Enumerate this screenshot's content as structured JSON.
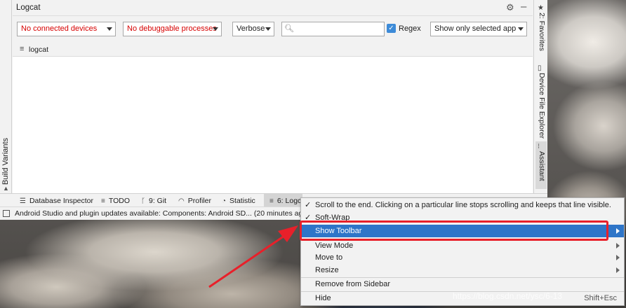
{
  "logcat_panel": {
    "title": "Logcat",
    "device_combo": "No connected devices",
    "process_combo": "No debuggable processes",
    "level_combo": "Verbose",
    "search": {
      "value": "",
      "placeholder": ""
    },
    "regex_label": "Regex",
    "regex_checked": true,
    "filter_combo": "Show only selected app",
    "sub_tab": "logcat"
  },
  "left_sidebar": {
    "build_variants": "Build Variants"
  },
  "right_sidebar": {
    "favorites": "2: Favorites",
    "device_file_explorer": "Device File Explorer",
    "assistant": "Assistant"
  },
  "bottom_tabs": [
    {
      "label": "Database Inspector",
      "icon": "database-icon"
    },
    {
      "label": "TODO",
      "icon": "list-icon"
    },
    {
      "label": "9: Git",
      "icon": "branch-icon"
    },
    {
      "label": "Profiler",
      "icon": "gauge-icon"
    },
    {
      "label": "Statistic",
      "icon": "pie-icon"
    },
    {
      "label": "6: Logcat",
      "icon": "lines-icon"
    }
  ],
  "status_message": "Android Studio and plugin updates available: Components: Android SD... (20 minutes ago)",
  "context_menu": {
    "items": [
      {
        "label": "Scroll to the end. Clicking on a particular line stops scrolling and keeps that line visible.",
        "checked": true
      },
      {
        "label": "Soft-Wrap",
        "checked": true
      },
      {
        "label": "Show Toolbar",
        "selected": true
      },
      {
        "label": "View Mode",
        "submenu": true
      },
      {
        "label": "Move to",
        "submenu": true
      },
      {
        "label": "Resize",
        "submenu": true
      },
      {
        "label": "Remove from Sidebar"
      },
      {
        "label": "Hide",
        "shortcut": "Shift+Esc"
      }
    ]
  },
  "watermark": "https://blog.csdn.net/ysc/6-13",
  "colors": {
    "selection": "#2e75c8",
    "highlight_box": "#e8202a",
    "error_text": "#d60000",
    "checkbox": "#3d8bd8"
  }
}
